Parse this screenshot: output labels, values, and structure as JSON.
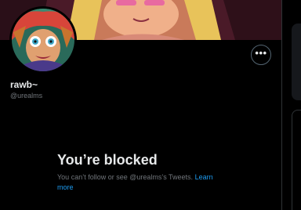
{
  "profile": {
    "display_name": "rawb~",
    "handle": "@urealms"
  },
  "header": {
    "more_label": "•••",
    "banner": "banner-art",
    "avatar": "avatar-art"
  },
  "blocked": {
    "title": "You’re blocked",
    "message": "You can’t follow or see @urealms’s Tweets.",
    "link_label": "Learn more"
  },
  "colors": {
    "background": "#000000",
    "text_primary": "#e7e9ea",
    "text_secondary": "#71767b",
    "accent": "#1d9bf0"
  }
}
